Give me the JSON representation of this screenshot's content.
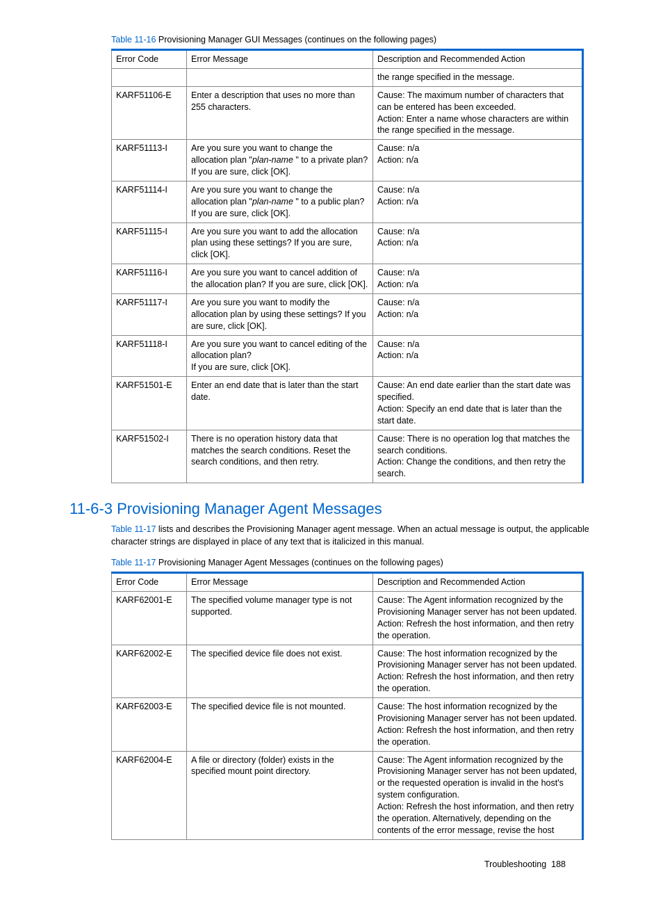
{
  "table1": {
    "caption_link": "Table 11-16",
    "caption_rest": " Provisioning Manager GUI Messages (continues on the following pages)",
    "headers": [
      "Error Code",
      "Error Message",
      "Description and Recommended Action"
    ],
    "rows": [
      {
        "code": "",
        "msg": "",
        "desc": "the range specified in the message."
      },
      {
        "code": "KARF51106-E",
        "msg": "Enter a description that uses no more than 255 characters.",
        "desc": "Cause: The maximum number of characters that can be entered has been exceeded.\nAction: Enter a name whose characters are within the range specified in the message."
      },
      {
        "code": "KARF51113-I",
        "msg_pre": "Are you sure you want to change the allocation plan \"",
        "msg_em": "plan-name ",
        "msg_post": "\" to a private plan?If you are sure, click [OK].",
        "desc": "Cause: n/a\nAction: n/a"
      },
      {
        "code": "KARF51114-I",
        "msg_pre": "Are you sure you want to change the allocation plan \"",
        "msg_em": "plan-name ",
        "msg_post": "\" to a public plan?If you are sure, click [OK].",
        "desc": "Cause: n/a\nAction: n/a"
      },
      {
        "code": "KARF51115-I",
        "msg": "Are you sure you want to add the allocation plan using these settings? If you are sure, click [OK].",
        "desc": "Cause: n/a\nAction: n/a"
      },
      {
        "code": "KARF51116-I",
        "msg": "Are you sure you want to cancel addition of the allocation plan? If you are sure, click [OK].",
        "desc": "Cause: n/a\nAction: n/a"
      },
      {
        "code": "KARF51117-I",
        "msg": "Are you sure you want to modify the allocation plan by using these settings? If you are sure, click [OK].",
        "desc": "Cause: n/a\nAction: n/a"
      },
      {
        "code": "KARF51118-I",
        "msg": "Are you sure you want to cancel editing of the allocation plan?\nIf you are sure, click [OK].",
        "desc": "Cause: n/a\nAction: n/a"
      },
      {
        "code": "KARF51501-E",
        "msg": "Enter an end date that is later than the start date.",
        "desc": "Cause: An end date earlier than the start date was specified.\nAction: Specify an end date that is later than the start date."
      },
      {
        "code": "KARF51502-I",
        "msg": "There is no operation history data that matches the search conditions. Reset the search conditions, and then retry.",
        "desc": "Cause: There is no operation log that matches the search conditions.\nAction: Change the conditions, and then retry the search."
      }
    ]
  },
  "section_heading": "11-6-3 Provisioning Manager Agent Messages",
  "section_body_link": "Table 11-17",
  "section_body_rest": " lists and describes the Provisioning Manager agent message. When an actual message is output, the applicable character strings are displayed in place of any text that is italicized in this manual.",
  "table2": {
    "caption_link": "Table 11-17",
    "caption_rest": " Provisioning Manager Agent Messages (continues on the following pages)",
    "headers": [
      "Error Code",
      "Error Message",
      "Description and Recommended Action"
    ],
    "rows": [
      {
        "code": "KARF62001-E",
        "msg": "The specified volume manager type is not supported.",
        "desc": "Cause: The Agent information recognized by the Provisioning Manager server has not been updated.\nAction: Refresh the host information, and then retry the operation."
      },
      {
        "code": "KARF62002-E",
        "msg": "The specified device file does not exist.",
        "desc": "Cause: The host information recognized by the Provisioning Manager server has not been updated.\nAction: Refresh the host information, and then retry the operation."
      },
      {
        "code": "KARF62003-E",
        "msg": "The specified device file is not mounted.",
        "desc": "Cause: The host information recognized by the Provisioning Manager server has not been updated.\nAction: Refresh the host information, and then retry the operation."
      },
      {
        "code": "KARF62004-E",
        "msg": "A file or directory (folder) exists in the specified mount point directory.",
        "desc": "Cause: The Agent information recognized by the Provisioning Manager server has not been updated, or the requested operation is invalid in the host's system configuration.\nAction: Refresh the host information, and then retry the operation. Alternatively, depending on the contents of the error message, revise the host"
      }
    ]
  },
  "footer_label": "Troubleshooting",
  "footer_page": "188"
}
